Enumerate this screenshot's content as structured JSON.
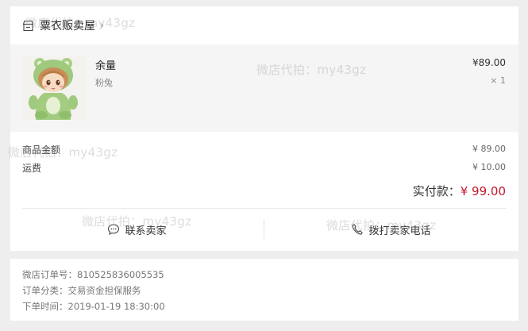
{
  "shop": {
    "name": "粟衣贩卖屋",
    "arrow": "›"
  },
  "product": {
    "name": "余量",
    "spec": "粉兔",
    "price": "¥89.00",
    "quantity": "× 1"
  },
  "fees": {
    "goods_label": "商品金额",
    "goods_value": "¥ 89.00",
    "shipping_label": "运费",
    "shipping_value": "¥ 10.00"
  },
  "total": {
    "label": "实付款：",
    "value": "¥ 99.00"
  },
  "actions": {
    "contact_label": "联系卖家",
    "call_label": "拨打卖家电话"
  },
  "order_info": {
    "order_no": "微店订单号：810525836005535",
    "order_type": "订单分类：交易资金担保服务",
    "order_time": "下单时间：2019-01-19 18:30:00"
  },
  "watermark": {
    "text": "微店代拍：my43gz"
  },
  "colors": {
    "accent": "#c4182b",
    "background": "#eeeeee",
    "product_bg": "#f5f5f5"
  }
}
